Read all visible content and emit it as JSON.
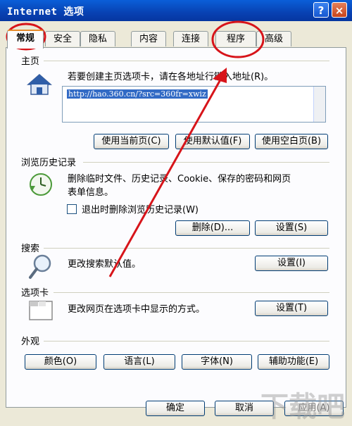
{
  "window": {
    "title": "Internet 选项",
    "help": "?",
    "close": "×"
  },
  "tabs": [
    {
      "label": "常规"
    },
    {
      "label": "安全"
    },
    {
      "label": "隐私"
    },
    {
      "label": "内容"
    },
    {
      "label": "连接"
    },
    {
      "label": "程序"
    },
    {
      "label": "高级"
    }
  ],
  "home": {
    "group": "主页",
    "desc": "若要创建主页选项卡，请在各地址行键入地址(R)。",
    "url": "http://hao.360.cn/?src=360fr=xwiz",
    "btn_current": "使用当前页(C)",
    "btn_default": "使用默认值(F)",
    "btn_blank": "使用空白页(B)"
  },
  "history": {
    "group": "浏览历史记录",
    "desc1": "删除临时文件、历史记录、Cookie、保存的密码和网页",
    "desc2": "表单信息。",
    "checkbox": "退出时删除浏览历史记录(W)",
    "btn_delete": "删除(D)...",
    "btn_settings": "设置(S)"
  },
  "search": {
    "group": "搜索",
    "desc": "更改搜索默认值。",
    "btn_settings": "设置(I)"
  },
  "tabsgroup": {
    "group": "选项卡",
    "desc": "更改网页在选项卡中显示的方式。",
    "btn_settings": "设置(T)"
  },
  "appearance": {
    "group": "外观",
    "btn_colors": "颜色(O)",
    "btn_lang": "语言(L)",
    "btn_fonts": "字体(N)",
    "btn_access": "辅助功能(E)"
  },
  "footer": {
    "ok": "确定",
    "cancel": "取消",
    "apply": "应用(A)"
  },
  "colors": {
    "annotation": "#d7141a",
    "selection": "#316ac5",
    "titlebar": "#0842b3"
  }
}
